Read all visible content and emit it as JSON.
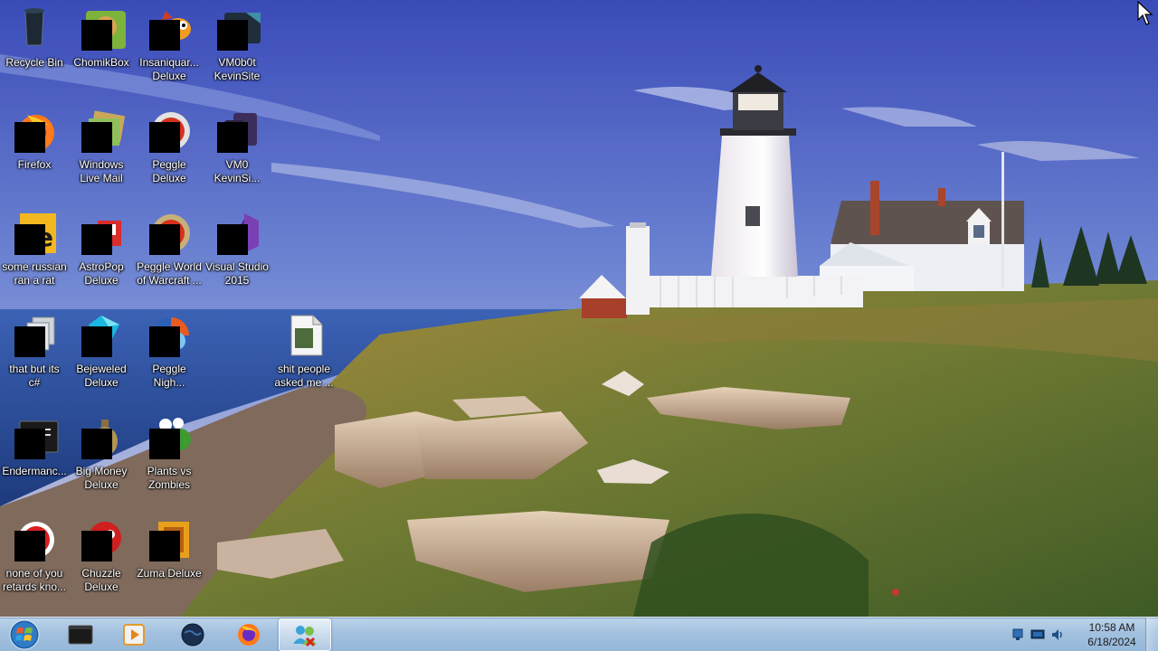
{
  "desktop": {
    "icons": [
      {
        "label": "Recycle Bin",
        "icon": "recycle-bin-icon",
        "censored": false
      },
      {
        "label": "ChomikBox",
        "icon": "chomikbox-icon",
        "censored": true
      },
      {
        "label": "Insaniquar...\nDeluxe",
        "icon": "insaniquarium-icon",
        "censored": true
      },
      {
        "label": "VM0b0t\nKevinSite",
        "icon": "vm-app-icon",
        "censored": true
      },
      {
        "label": "Firefox",
        "icon": "firefox-icon",
        "censored": true
      },
      {
        "label": "Windows\nLive Mail",
        "icon": "mail-icon",
        "censored": true
      },
      {
        "label": "Peggle\nDeluxe",
        "icon": "peggle-icon",
        "censored": true
      },
      {
        "label": "VM0\nKevinSi...",
        "icon": "vm-app-icon",
        "censored": true
      },
      {
        "label": "some russian\nran a rat",
        "icon": "java-file-icon",
        "censored": true
      },
      {
        "label": "AstroPop\nDeluxe",
        "icon": "astropop-icon",
        "censored": true
      },
      {
        "label": "Peggle World\nof Warcraft ...",
        "icon": "peggle-icon",
        "censored": true
      },
      {
        "label": "Visual Studio\n2015",
        "icon": "visual-studio-icon",
        "censored": true
      },
      {
        "label": "that but its\nc#",
        "icon": "files-icon",
        "censored": true
      },
      {
        "label": "Bejeweled\nDeluxe",
        "icon": "bejeweled-icon",
        "censored": true
      },
      {
        "label": "Peggle\nNigh...",
        "icon": "peggle-nights-icon",
        "censored": true
      },
      {
        "label": "shit people\nasked me ...",
        "icon": "document-icon",
        "censored": false
      },
      {
        "label": "Endermanc...",
        "icon": "terminal-icon",
        "censored": true
      },
      {
        "label": "Big Money\nDeluxe",
        "icon": "big-money-icon",
        "censored": true
      },
      {
        "label": "Plants vs\nZombies",
        "icon": "plants-vs-zombies-icon",
        "censored": true
      },
      {
        "label": "none of you\nretards kno...",
        "icon": "red-ball-icon",
        "censored": true
      },
      {
        "label": "Chuzzle\nDeluxe",
        "icon": "chuzzle-icon",
        "censored": true
      },
      {
        "label": "Zuma Deluxe",
        "icon": "zuma-icon",
        "censored": true
      }
    ]
  },
  "taskbar": {
    "start": {
      "icon": "windows-orb-icon"
    },
    "buttons": [
      {
        "icon": "terminal-icon",
        "active": false
      },
      {
        "icon": "media-player-icon",
        "active": false
      },
      {
        "icon": "globe-icon",
        "active": false
      },
      {
        "icon": "firefox-icon",
        "active": false
      },
      {
        "icon": "users-icon",
        "active": true
      }
    ],
    "tray": [
      {
        "icon": "network-icon"
      },
      {
        "icon": "monitor-icon"
      },
      {
        "icon": "volume-icon"
      }
    ],
    "clock": {
      "time": "10:58 AM",
      "date": "6/18/2024"
    }
  }
}
